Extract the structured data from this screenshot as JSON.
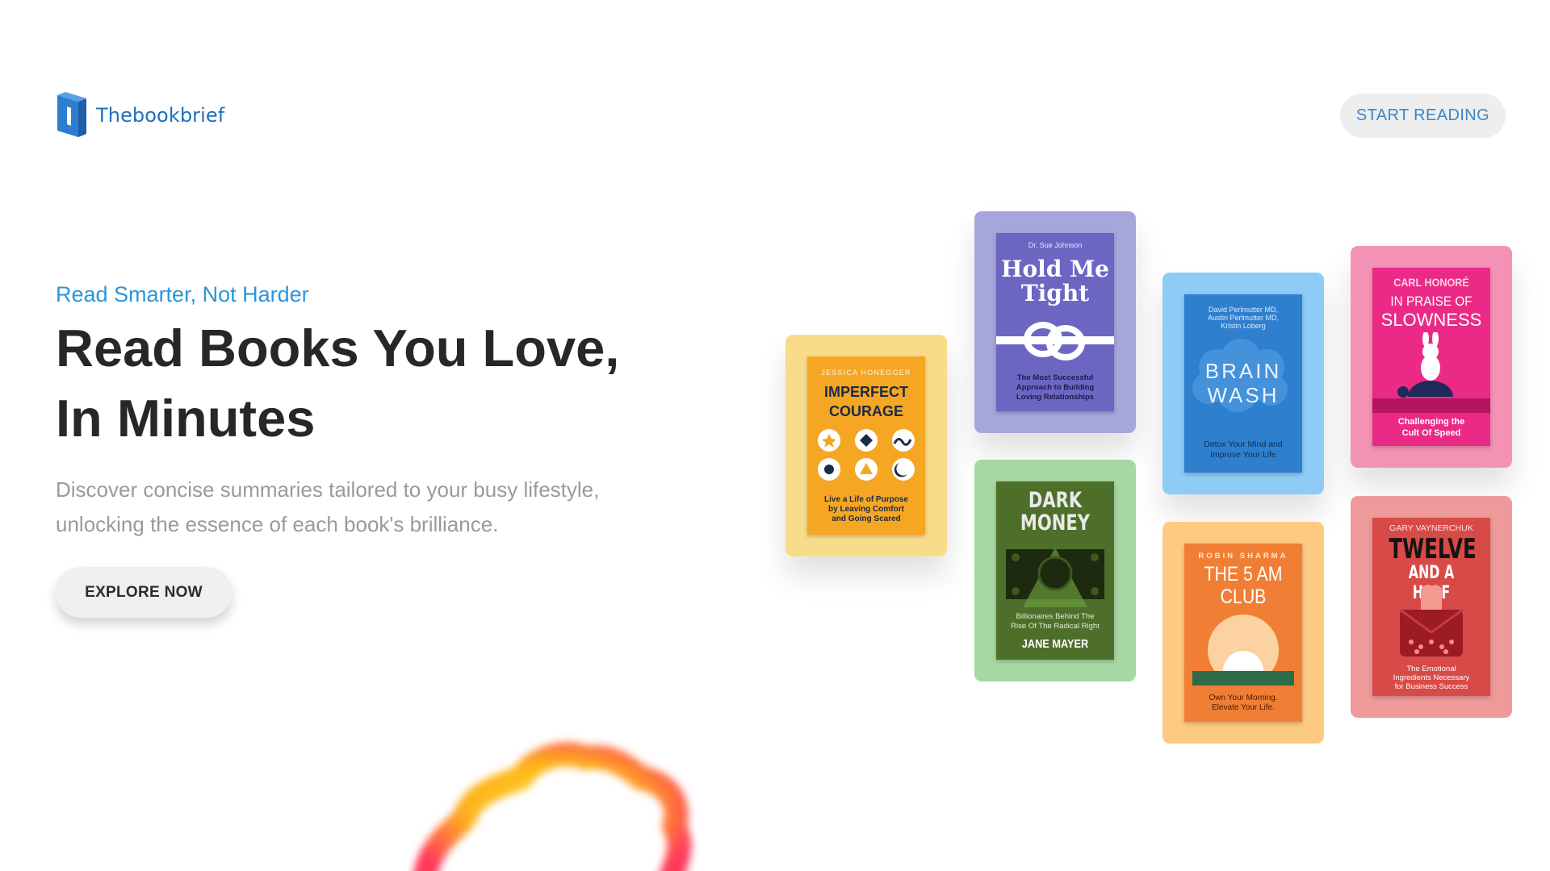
{
  "brand": {
    "name": "Thebookbrief"
  },
  "nav": {
    "cta_label": "START READING"
  },
  "hero": {
    "tagline": "Read Smarter, Not Harder",
    "headline": "Read Books You Love, In Minutes",
    "description": "Discover concise summaries tailored to your busy lifestyle, unlocking the essence of each book's brilliance.",
    "cta_label": "EXPLORE NOW"
  },
  "colors": {
    "brand_blue": "#1e6fc0",
    "accent_blue": "#2996dc",
    "headline": "#27272a",
    "muted_text": "#9a9a9a"
  },
  "books": [
    {
      "author": "JESSICA HONEGGER",
      "title_lines": [
        "IMPERFECT",
        "COURAGE"
      ],
      "subtitle_lines": [
        "Live a Life of Purpose",
        "by Leaving Comfort",
        "and Going Scared"
      ],
      "tile_color": "#f9dc8a",
      "cover_color": "#f5a623"
    },
    {
      "author": "Dr. Sue Johnson",
      "title_lines": [
        "Hold Me",
        "Tight"
      ],
      "subtitle_lines": [
        "The Most Successful",
        "Approach to Building",
        "Loving Relationships"
      ],
      "tile_color": "#a5a7dc",
      "cover_color": "#6c66c2"
    },
    {
      "title_lines": [
        "DARK",
        "MONEY"
      ],
      "subtitle_lines": [
        "Billionaires Behind The",
        "Rise Of The Radical Right"
      ],
      "author": "JANE MAYER",
      "tile_color": "#a7d7a2",
      "cover_color": "#4e6f2a"
    },
    {
      "author_lines": [
        "David Perlmutter MD,",
        "Austin Perlmutter MD,",
        "Kristin Loberg"
      ],
      "title_lines": [
        "BRAIN",
        "WASH"
      ],
      "subtitle_lines": [
        "Detox Your Mind and",
        "Improve Your Life"
      ],
      "tile_color": "#8ecbf5",
      "cover_color": "#2f7fcf"
    },
    {
      "author": "ROBIN SHARMA",
      "title_lines": [
        "THE 5 AM",
        "CLUB"
      ],
      "subtitle_lines": [
        "Own Your Morning.",
        "Elevate Your Life."
      ],
      "tile_color": "#fdca82",
      "cover_color": "#f07f35"
    },
    {
      "author": "CARL HONORÉ",
      "title_lines": [
        "IN PRAISE OF",
        "SLOWNESS"
      ],
      "subtitle_lines": [
        "Challenging the",
        "Cult Of Speed"
      ],
      "tile_color": "#f492b5",
      "cover_color": "#ea2a86"
    },
    {
      "author": "GARY VAYNERCHUK",
      "title_lines": [
        "TWELVE",
        "AND A HALF"
      ],
      "subtitle_lines": [
        "The Emotional",
        "Ingredients Necessary",
        "for Business Success"
      ],
      "tile_color": "#ef9a9a",
      "cover_color": "#d84a47"
    }
  ]
}
